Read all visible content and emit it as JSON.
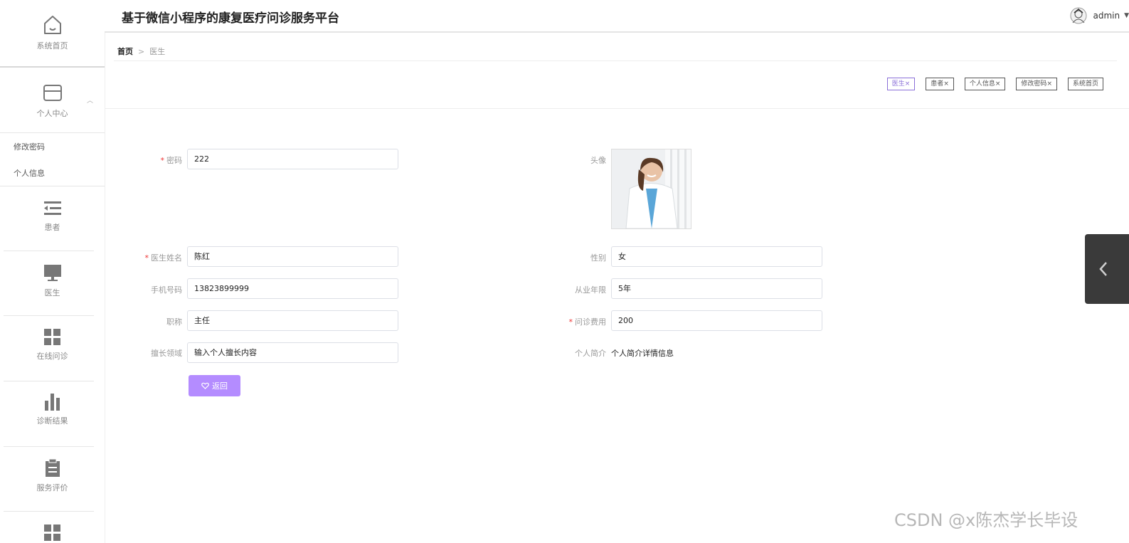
{
  "header": {
    "title": "基于微信小程序的康复医疗问诊服务平台",
    "user": "admin"
  },
  "sidebar": {
    "home": "系统首页",
    "personal_center": "个人中心",
    "change_password": "修改密码",
    "personal_info": "个人信息",
    "patients": "患者",
    "doctors": "医生",
    "online_consult": "在线问诊",
    "diagnosis_results": "诊断结果",
    "service_reviews": "服务评价"
  },
  "breadcrumb": {
    "home": "首页",
    "separator": ">",
    "current": "医生"
  },
  "tags": [
    {
      "label": "医生",
      "close": "×"
    },
    {
      "label": "患者",
      "close": "×"
    },
    {
      "label": "个人信息",
      "close": "×"
    },
    {
      "label": "修改密码",
      "close": "×"
    },
    {
      "label": "系统首页"
    }
  ],
  "form": {
    "password": {
      "label": "密码",
      "value": "222"
    },
    "avatar": {
      "label": "头像"
    },
    "doctor_name": {
      "label": "医生姓名",
      "value": "陈红"
    },
    "gender": {
      "label": "性别",
      "value": "女"
    },
    "phone": {
      "label": "手机号码",
      "value": "13823899999"
    },
    "years": {
      "label": "从业年限",
      "value": "5年"
    },
    "title": {
      "label": "职称",
      "value": "主任"
    },
    "fee": {
      "label": "问诊费用",
      "value": "200"
    },
    "specialty": {
      "label": "擅长领域",
      "value": "输入个人擅长内容"
    },
    "intro": {
      "label": "个人简介",
      "value": "个人简介详情信息"
    },
    "back_button": "返回"
  },
  "watermark": "CSDN @x陈杰学长毕设",
  "colors": {
    "accent": "#b48cff",
    "active_tag": "#8a6ed8",
    "required": "#e33333"
  }
}
